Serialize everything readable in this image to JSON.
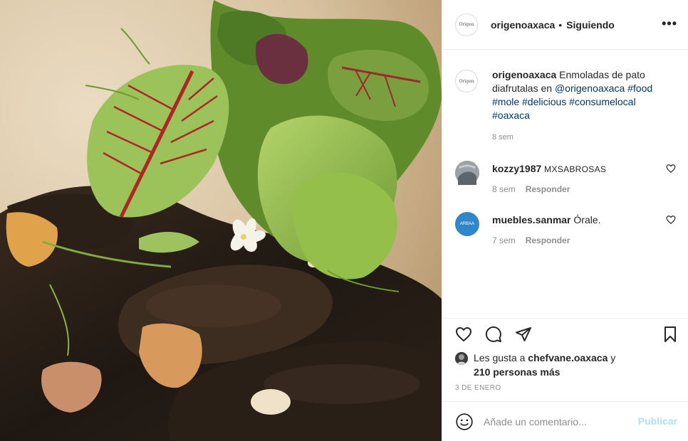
{
  "post": {
    "image_alt": "",
    "username": "origenoaxaca",
    "separator": "•",
    "follow_status": "Siguiendo",
    "more_icon": "more-horizontal-icon",
    "avatar_text": "Origen"
  },
  "caption": {
    "username": "origenoaxaca",
    "text": " Enmoladas de pato diafrutalas en ",
    "mention": "@origenoaxaca",
    "hashtags": " #food #mole #delicious #consumelocal #oaxaca",
    "time": "8 sem"
  },
  "comments": [
    {
      "username": "kozzy1987",
      "text": "MXSABROSAS",
      "time": "8 sem",
      "reply": "Responder",
      "avatar_color": "#8a9098"
    },
    {
      "username": "muebles.sanmar",
      "text": "Órale.",
      "time": "7 sem",
      "reply": "Responder",
      "avatar_color": "#2f86c8",
      "avatar_text": "ARBAA"
    }
  ],
  "actions": {
    "like_icon": "heart-icon",
    "comment_icon": "comment-icon",
    "share_icon": "send-icon",
    "save_icon": "bookmark-icon"
  },
  "likes": {
    "prefix": "Les gusta a ",
    "user": "chefvane.oaxaca",
    "middle": " y ",
    "others": "210 personas más"
  },
  "date": "3 DE ENERO",
  "add_comment": {
    "emoji_icon": "emoji-icon",
    "placeholder": "Añade un comentario...",
    "publish_label": "Publicar"
  },
  "colors": {
    "link": "#00376b",
    "muted": "#8e8e8e",
    "publish_disabled": "#b2dffc"
  }
}
